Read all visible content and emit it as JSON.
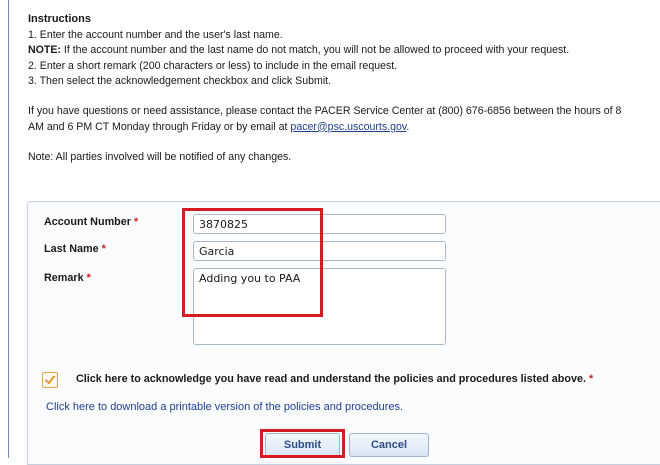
{
  "instructions": {
    "title": "Instructions",
    "step1": "1. Enter the account number and the user's last name.",
    "note_label": "NOTE:",
    "note_text": " If the account number and the last name do not match, you will not be allowed to proceed with your request.",
    "step2": "2. Enter a short remark (200 characters or less) to include in the email request.",
    "step3": "3. Then select the acknowledgement checkbox and click Submit.",
    "contact_line1": "If you have questions or need assistance, please contact the PACER Service Center at (800) 676-6856 between the hours of 8",
    "contact_line2_prefix": "AM and 6 PM CT Monday through Friday or by email at ",
    "email": "pacer@psc.uscourts.gov",
    "contact_line2_suffix": ".",
    "parties_note": "Note: All parties involved will be notified of any changes."
  },
  "form": {
    "account_number": {
      "label": "Account Number",
      "required_mark": "*",
      "value": "3870825"
    },
    "last_name": {
      "label": "Last Name",
      "required_mark": "*",
      "value": "Garcia"
    },
    "remark": {
      "label": "Remark",
      "required_mark": "*",
      "value": "Adding you to PAA"
    },
    "acknowledge": {
      "label": "Click here to acknowledge you have read and understand the policies and procedures listed above.",
      "required_mark": "*",
      "checked": true
    },
    "download_link": "Click here to download a printable version of the policies and procedures.",
    "submit_label": "Submit",
    "cancel_label": "Cancel"
  },
  "colors": {
    "highlight": "#d71b22",
    "link": "#1f3f8f",
    "required": "#c82020",
    "checkbox_border": "#e2a24a"
  }
}
